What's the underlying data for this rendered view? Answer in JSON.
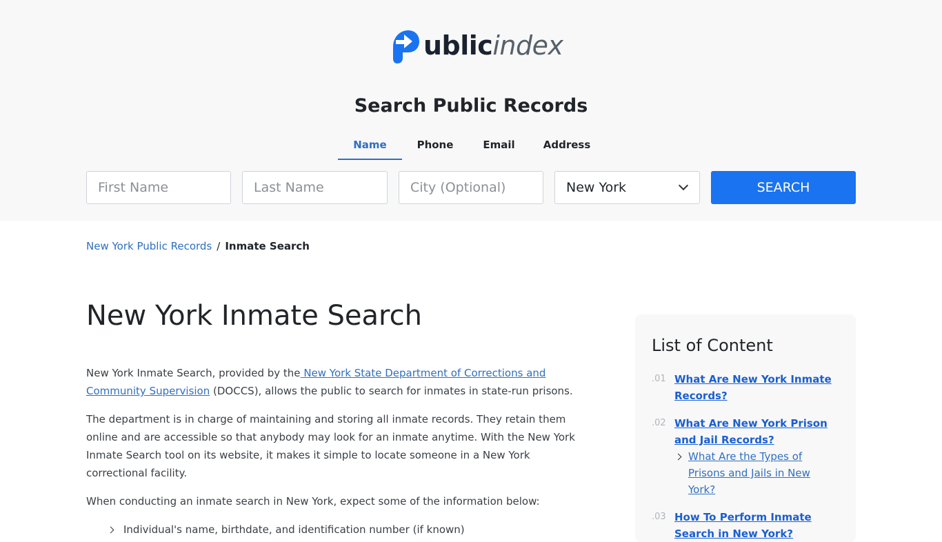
{
  "logo": {
    "text_bold": "ublic",
    "text_light": "index",
    "brand_color": "#1a73f0"
  },
  "hero": {
    "title": "Search Public Records"
  },
  "tabs": [
    {
      "label": "Name",
      "active": true
    },
    {
      "label": "Phone",
      "active": false
    },
    {
      "label": "Email",
      "active": false
    },
    {
      "label": "Address",
      "active": false
    }
  ],
  "search": {
    "first_placeholder": "First Name",
    "last_placeholder": "Last Name",
    "city_placeholder": "City (Optional)",
    "state_value": "New York",
    "button_label": "SEARCH",
    "button_color": "#1a73f0"
  },
  "breadcrumb": {
    "parent": "New York Public Records",
    "separator": "/",
    "current": "Inmate Search"
  },
  "page": {
    "title": "New York Inmate Search"
  },
  "article": {
    "p1_before": "New York Inmate Search, provided by the",
    "p1_link": " New York State Department of Corrections and Community Supervision",
    "p1_after": " (DOCCS), allows the public to search for inmates in state-run prisons.",
    "p2": "The department is in charge of maintaining and storing all inmate records. They retain them online and are accessible so that anybody may look for an inmate anytime. With the New York Inmate Search tool on its website, it makes it simple to locate someone in a New York correctional facility.",
    "p3": "When conducting an inmate search in New York, expect some of the information below:",
    "list": [
      "Individual's name, birthdate, and identification number (if known)"
    ]
  },
  "toc": {
    "title": "List of Content",
    "items": [
      {
        "num": ".01",
        "label": "What Are New York Inmate Records?"
      },
      {
        "num": ".02",
        "label": "What Are New York Prison and Jail Records?",
        "sub": "What Are the Types of Prisons and Jails in New York?"
      },
      {
        "num": ".03",
        "label": "How To Perform Inmate Search in New York?"
      }
    ]
  }
}
